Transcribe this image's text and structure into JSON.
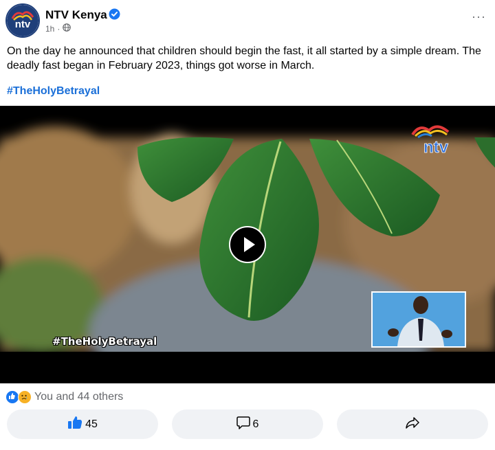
{
  "post": {
    "page_name": "NTV Kenya",
    "time": "1h",
    "dot": "·",
    "more": "···",
    "text": "On the day he announced that children should begin the fast, it all started by a simple dream. The deadly fast began in February 2023, things got worse in March.",
    "hashtag": "#TheHolyBetrayal"
  },
  "video": {
    "overlay_hashtag": "#TheHolyBetrayal",
    "logo_text": "ntv"
  },
  "reactions": {
    "summary": "You and 44 others"
  },
  "actions": {
    "like_count": "45",
    "comment_count": "6"
  },
  "icons": {
    "verified": "verified-badge-icon",
    "globe": "globe-icon",
    "more": "more-options-icon",
    "play": "play-icon",
    "like": "thumbs-up-icon",
    "comment": "comment-icon",
    "share": "share-icon"
  },
  "colors": {
    "brand_blue": "#1877f2",
    "hashtag_blue": "#1a6fd8",
    "button_bg": "#f0f2f5",
    "meta_gray": "#65676b"
  }
}
